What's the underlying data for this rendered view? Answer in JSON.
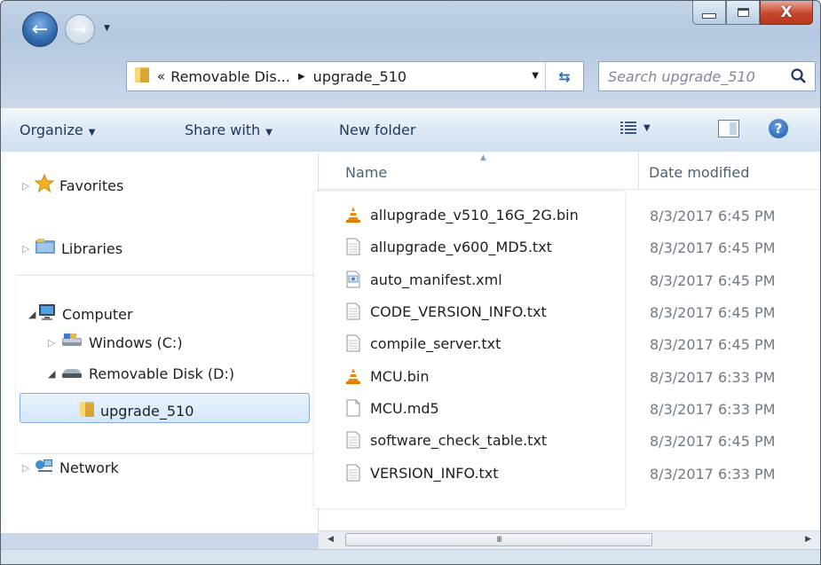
{
  "window": {
    "caption_buttons": [
      "minimize",
      "maximize",
      "close"
    ],
    "close_glyph": "X"
  },
  "address_bar": {
    "overflow_glyph": "«",
    "segments": [
      "Removable Dis...",
      "upgrade_510"
    ],
    "separator_glyph": "▶"
  },
  "search": {
    "placeholder": "Search upgrade_510"
  },
  "toolbar": {
    "organize": "Organize",
    "share_with": "Share with",
    "new_folder": "New folder",
    "help_glyph": "?"
  },
  "nav_pane": {
    "favorites": "Favorites",
    "libraries": "Libraries",
    "computer": "Computer",
    "windows_drive": "Windows (C:)",
    "removable_disk": "Removable Disk (D:)",
    "upgrade_folder": "upgrade_510",
    "network": "Network"
  },
  "columns": {
    "name": "Name",
    "date_modified": "Date modified"
  },
  "files": [
    {
      "name": "allupgrade_v510_16G_2G.bin",
      "icon": "vlc-cone-icon",
      "date": "8/3/2017 6:45 PM"
    },
    {
      "name": "allupgrade_v600_MD5.txt",
      "icon": "text-file-icon",
      "date": "8/3/2017 6:45 PM"
    },
    {
      "name": "auto_manifest.xml",
      "icon": "xml-file-icon",
      "date": "8/3/2017 6:45 PM"
    },
    {
      "name": "CODE_VERSION_INFO.txt",
      "icon": "text-file-icon",
      "date": "8/3/2017 6:45 PM"
    },
    {
      "name": "compile_server.txt",
      "icon": "text-file-icon",
      "date": "8/3/2017 6:45 PM"
    },
    {
      "name": "MCU.bin",
      "icon": "vlc-cone-icon",
      "date": "8/3/2017 6:33 PM"
    },
    {
      "name": "MCU.md5",
      "icon": "blank-file-icon",
      "date": "8/3/2017 6:33 PM"
    },
    {
      "name": "software_check_table.txt",
      "icon": "text-file-icon",
      "date": "8/3/2017 6:45 PM"
    },
    {
      "name": "VERSION_INFO.txt",
      "icon": "text-file-icon",
      "date": "8/3/2017 6:33 PM"
    }
  ],
  "scrollbar": {
    "thumb_glyph": "III"
  },
  "colors": {
    "selection_border": "#84acdd",
    "accent_blue": "#2f68ab",
    "vlc_orange": "#f08a00"
  }
}
